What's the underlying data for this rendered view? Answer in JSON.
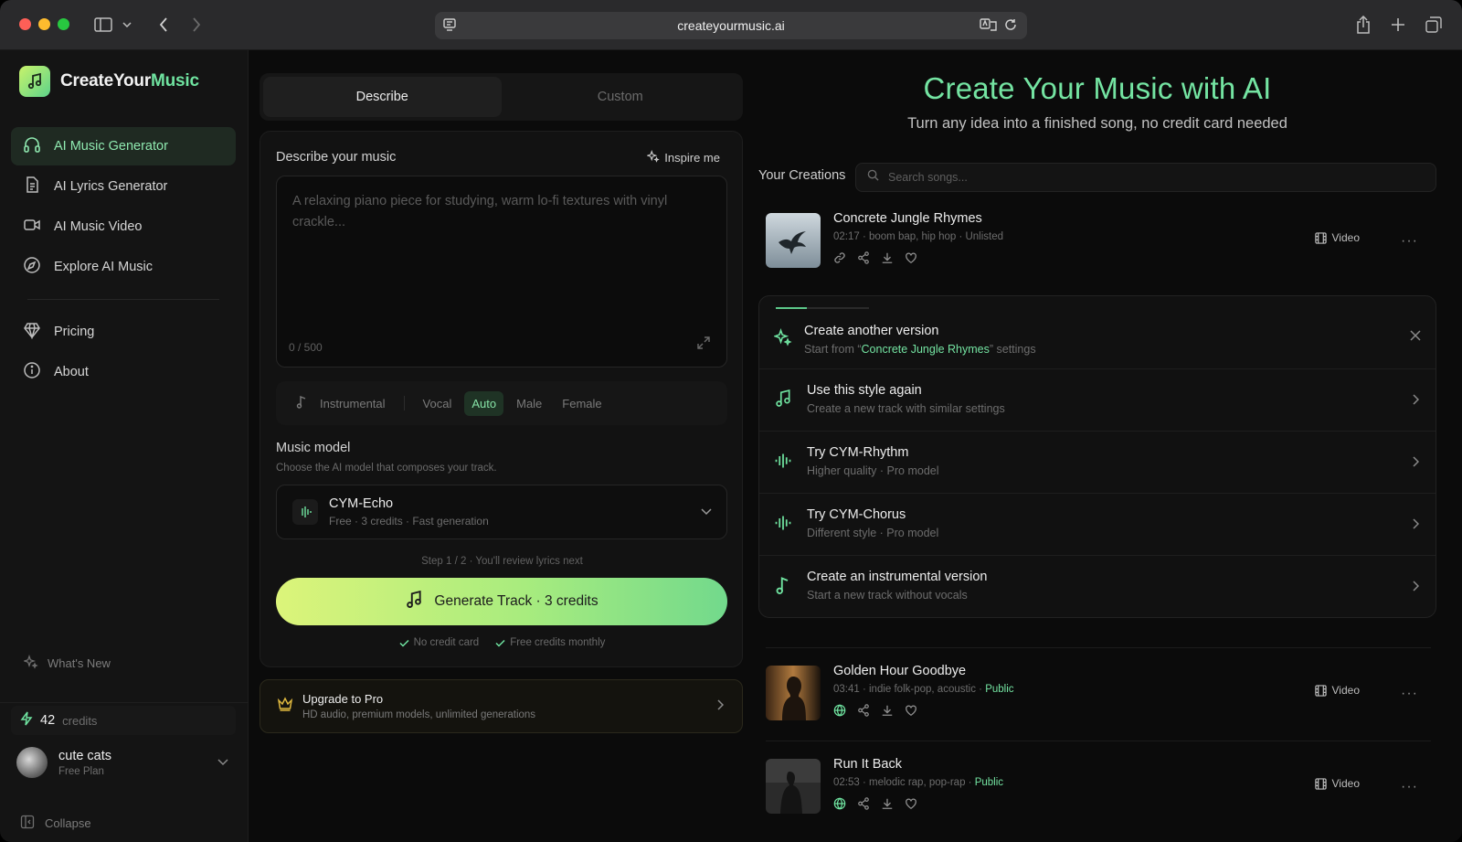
{
  "browser": {
    "url": "createyourmusic.ai"
  },
  "sidebar": {
    "logo": {
      "part1": "CreateYour",
      "part2": "Music"
    },
    "items": [
      {
        "label": "AI Music Generator",
        "icon": "headphones-icon",
        "active": true
      },
      {
        "label": "AI Lyrics Generator",
        "icon": "document-icon"
      },
      {
        "label": "AI Music Video",
        "icon": "video-camera-icon"
      },
      {
        "label": "Explore AI Music",
        "icon": "compass-icon"
      },
      {
        "label": "Pricing",
        "icon": "diamond-icon"
      },
      {
        "label": "About",
        "icon": "info-icon"
      }
    ],
    "whats_new": "What's New",
    "credits": {
      "count": "42",
      "label": "credits"
    },
    "user": {
      "name": "cute cats",
      "plan": "Free Plan"
    },
    "collapse": "Collapse"
  },
  "composer": {
    "tabs": [
      {
        "label": "Describe",
        "active": true
      },
      {
        "label": "Custom"
      }
    ],
    "describe_title": "Describe your music",
    "inspire": "Inspire me",
    "placeholder": "A relaxing piano piece for studying, warm lo-fi textures with vinyl crackle...",
    "counter": "0 / 500",
    "voice": {
      "instrumental": "Instrumental",
      "vocal": "Vocal",
      "auto": "Auto",
      "male": "Male",
      "female": "Female"
    },
    "model": {
      "title": "Music model",
      "subtitle": "Choose the AI model that composes your track.",
      "name": "CYM-Echo",
      "meta": "Free · 3 credits · Fast generation"
    },
    "step_note": "Step 1 / 2 · You'll review lyrics next",
    "generate_label": "Generate Track · 3 credits",
    "checks": [
      "No credit card",
      "Free credits monthly"
    ],
    "upgrade": {
      "title": "Upgrade to Pro",
      "subtitle": "HD audio, premium models, unlimited generations"
    }
  },
  "hero": {
    "title": "Create Your Music with AI",
    "subtitle": "Turn any idea into a finished song, no credit card needed"
  },
  "creations": {
    "label": "Your Creations",
    "search_placeholder": "Search songs...",
    "songs": [
      {
        "title": "Concrete Jungle Rhymes",
        "meta": "02:17 · boom bap, hip hop · Unlisted",
        "visibility": "",
        "video": "Video"
      },
      {
        "title": "Golden Hour Goodbye",
        "meta": "03:41 · indie folk-pop, acoustic · ",
        "visibility": "Public",
        "video": "Video"
      },
      {
        "title": "Run It Back",
        "meta": "02:53 · melodic rap, pop-rap · ",
        "visibility": "Public",
        "video": "Video"
      }
    ]
  },
  "versions": {
    "progress": 0.33,
    "title": "Create another version",
    "sub_prefix": "Start from “",
    "sub_song": "Concrete Jungle Rhymes",
    "sub_suffix": "” settings",
    "options": [
      {
        "title": "Use this style again",
        "subtitle": "Create a new track with similar settings"
      },
      {
        "title": "Try CYM-Rhythm",
        "subtitle": "Higher quality · Pro model"
      },
      {
        "title": "Try CYM-Chorus",
        "subtitle": "Different style · Pro model"
      },
      {
        "title": "Create an instrumental version",
        "subtitle": "Start a new track without vocals"
      }
    ]
  },
  "colors": {
    "accent": "#74e4a2",
    "gradient_start": "#dcf47a",
    "gradient_end": "#72d98c"
  }
}
